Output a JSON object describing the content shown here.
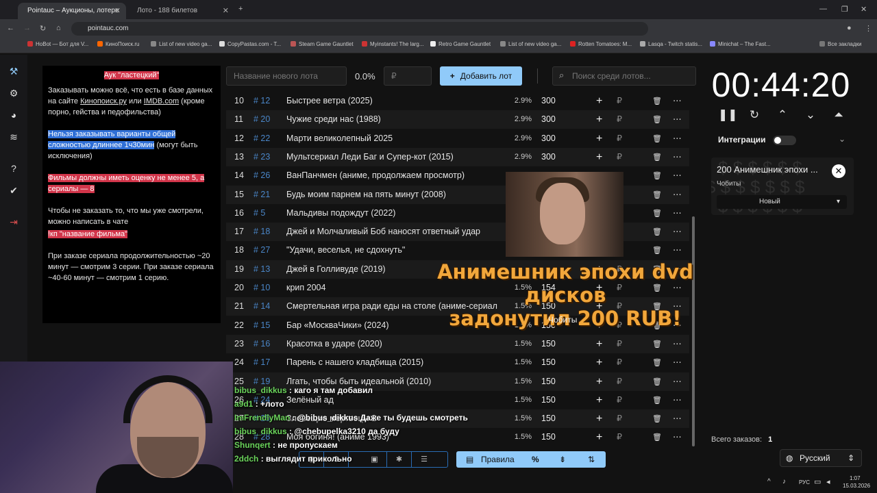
{
  "browser": {
    "tabs": [
      {
        "title": "Pointauc – Аукционы, лотере",
        "active": true
      },
      {
        "title": "Лото - 188 билетов",
        "active": false
      }
    ],
    "url": "pointauc.com",
    "bookmarks": [
      "HoBot — Бот для V...",
      "КиноПоиск.ru",
      "List of new video ga...",
      "CopyPastas.com - T...",
      "Steam Game Gauntlet",
      "Myinstants! The larg...",
      "Retro Game Gauntlet",
      "List of new video ga...",
      "Rotten Tomatoes: M...",
      "Lasqa - Twitch statis...",
      "Minichat – The Fast...",
      "Все закладки"
    ]
  },
  "rules": {
    "title": "Аук \"ластецкий\"",
    "p1": "Заказывать можно всё, что есть в базе данных на сайте ",
    "p1_link1": "Кинопоиск.ру",
    "p1_mid": " или ",
    "p1_link2": "IMDB.com",
    "p1_end": " (кроме порно, гейства и педофильства)",
    "p2_hl": "Нельзя заказывать варианты общей сложностью длиннее 1ч30мин",
    "p2_end": " (могут быть исключения)",
    "p3_hl": "Фильмы должны иметь оценку не менее 5, а сериалы — 8",
    "p4": "Чтобы не заказать то, что мы уже смотрели, можно написать в чате",
    "p4_hl": "!кп \"название фильма\"",
    "p5": "При заказе сериала продолжительностью ~20 минут — смотрим 3 серии. При заказе сериала ~40-60 минут — смотрим 1 серию."
  },
  "controls": {
    "new_lot_placeholder": "Название нового лота",
    "percent": "0.0%",
    "amount_placeholder": "₽",
    "add_button": "Добавить лот",
    "search_placeholder": "Поиск среди лотов..."
  },
  "lots": [
    {
      "n": "10",
      "id": "# 12",
      "name": "Быстрее ветра (2025)",
      "pct": "2.9%",
      "amount": "300"
    },
    {
      "n": "11",
      "id": "# 20",
      "name": "Чужие среди нас (1988)",
      "pct": "2.9%",
      "amount": "300"
    },
    {
      "n": "12",
      "id": "# 22",
      "name": "Марти великолепный 2025",
      "pct": "2.9%",
      "amount": "300"
    },
    {
      "n": "13",
      "id": "# 23",
      "name": "Мультсериал Леди Баг и Супер-кот (2015)",
      "pct": "2.9%",
      "amount": "300"
    },
    {
      "n": "14",
      "id": "# 26",
      "name": "ВанПанчмен (аниме, продолжаем просмотр)",
      "pct": "",
      "amount": ""
    },
    {
      "n": "15",
      "id": "# 21",
      "name": "Будь моим парнем на пять минут (2008)",
      "pct": "",
      "amount": ""
    },
    {
      "n": "16",
      "id": "# 5",
      "name": "Мальдивы подождут (2022)",
      "pct": "",
      "amount": ""
    },
    {
      "n": "17",
      "id": "# 18",
      "name": "Джей и Молчаливый Боб наносят ответный удар",
      "pct": "",
      "amount": ""
    },
    {
      "n": "18",
      "id": "# 27",
      "name": "\"Удачи, веселья, не сдохнуть\"",
      "pct": "",
      "amount": ""
    },
    {
      "n": "19",
      "id": "# 13",
      "name": "Джей в Голливуде (2019)",
      "pct": "",
      "amount": ""
    },
    {
      "n": "20",
      "id": "# 10",
      "name": "крип 2004",
      "pct": "1.5%",
      "amount": "154"
    },
    {
      "n": "21",
      "id": "# 14",
      "name": "Смертельная игра ради еды на столе (аниме-сериал",
      "pct": "1.5%",
      "amount": "150"
    },
    {
      "n": "22",
      "id": "# 15",
      "name": "Бар «МоскваЧики» (2024)",
      "pct": "1.5%",
      "amount": "150"
    },
    {
      "n": "23",
      "id": "# 16",
      "name": "Красотка в ударе (2020)",
      "pct": "1.5%",
      "amount": "150"
    },
    {
      "n": "24",
      "id": "# 17",
      "name": "Парень с нашего кладбища (2015)",
      "pct": "1.5%",
      "amount": "150"
    },
    {
      "n": "25",
      "id": "# 19",
      "name": "Лгать, чтобы быть идеальной (2010)",
      "pct": "1.5%",
      "amount": "150"
    },
    {
      "n": "26",
      "id": "# 24",
      "name": "Зелёный ад",
      "pct": "1.5%",
      "amount": "150"
    },
    {
      "n": "27",
      "id": "# 25",
      "name": "Зловещие мертвецы 2",
      "pct": "1.5%",
      "amount": "150"
    },
    {
      "n": "28",
      "id": "# 28",
      "name": "Моя богиня! (аниме 1993)",
      "pct": "1.5%",
      "amount": "150"
    }
  ],
  "row_icons": {
    "plus": "+",
    "currency": "₽",
    "delete": "trash-icon",
    "more": "⋯"
  },
  "timer": "00:44:20",
  "integrations_label": "Интеграции",
  "donation": {
    "title": "200 Анимешник эпохи ...",
    "user": "Чобиты",
    "status": "Новый"
  },
  "total_label": "Всего заказов:",
  "total_value": "1",
  "language": "Русский",
  "bottom": {
    "rules_label": "Правила",
    "percent_icon": "%"
  },
  "alert": {
    "line1": "Анимешник эпохи dvd дисков",
    "line2": "задонутил 200 RUB!",
    "user": "Чобиты"
  },
  "chat": [
    {
      "user": "bibus_dikkus",
      "text": ": каго я там добавил"
    },
    {
      "user": "a9d1",
      "text": ": +лото"
    },
    {
      "user": "ImFrendlyMan",
      "text": ": @bibus_dikkus Даже ты будешь смотреть"
    },
    {
      "user": "bibus_dikkus",
      "text": ": @chebupelka3210 да буду"
    },
    {
      "user": "Shunqert",
      "text": ": не пропускаем"
    },
    {
      "user": "2ddch",
      "text": ": выглядит прикольно"
    }
  ],
  "taskbar": {
    "lang": "РУС",
    "time": "1:07",
    "date": "15.03.2026"
  },
  "colors": {
    "accent": "#90caf9",
    "highlight_red": "#d2354a",
    "highlight_blue": "#2f6fd6",
    "alert": "#f2a73b"
  }
}
